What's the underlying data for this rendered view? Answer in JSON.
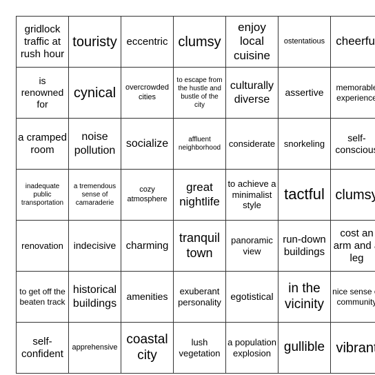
{
  "card": {
    "rows": [
      [
        "gridlock traffic at rush hour",
        "touristy",
        "eccentric",
        "clumsy",
        "enjoy local cuisine",
        "ostentatious",
        "cheerful"
      ],
      [
        "is renowned for",
        "cynical",
        "overcrowded cities",
        "to escape from the hustle and bustle of the city",
        "culturally diverse",
        "assertive",
        "memorable experience"
      ],
      [
        "a cramped room",
        "noise pollution",
        "socialize",
        "affluent neighborhood",
        "considerate",
        "snorkeling",
        "self-conscious"
      ],
      [
        "inadequate public transportation",
        "a tremendous sense of camaraderie",
        "cozy atmosphere",
        "great nightlife",
        "to achieve a minimalist style",
        "tactful",
        "clumsy"
      ],
      [
        "renovation",
        "indecisive",
        "charming",
        "tranquil town",
        "panoramic view",
        "run-down buildings",
        "cost an arm and a leg"
      ],
      [
        "to get off the beaten track",
        "historical buildings",
        "amenities",
        "exuberant personality",
        "egotistical",
        "in the vicinity",
        "nice sense of community"
      ],
      [
        "self-confident",
        "apprehensive",
        "coastal city",
        "lush vegetation",
        "a population explosion",
        "gullible",
        "vibrant"
      ]
    ]
  }
}
